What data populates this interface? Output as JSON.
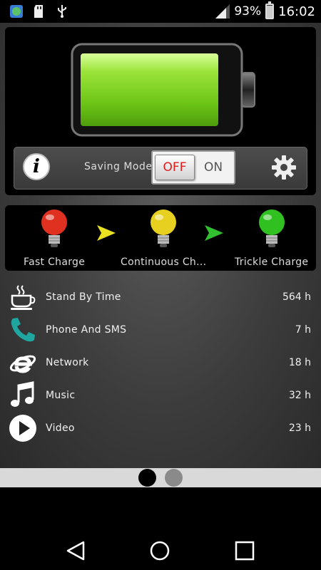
{
  "status_bar": {
    "battery_percent": "93%",
    "time": "16:02",
    "icons": [
      "app-icon",
      "sd-card-icon",
      "usb-icon",
      "signal-icon",
      "battery-charging-icon"
    ]
  },
  "battery": {
    "level": 0.93
  },
  "controls": {
    "info_icon_text": "i",
    "saving_mode_label": "Saving Mode",
    "toggle_off": "OFF",
    "toggle_on": "ON"
  },
  "stages": [
    {
      "label": "Fast Charge",
      "color": "#e03020"
    },
    {
      "label": "Continuous Ch...",
      "color": "#e8d020"
    },
    {
      "label": "Trickle Charge",
      "color": "#30c020"
    }
  ],
  "arrows": [
    {
      "color": "#e8e020"
    },
    {
      "color": "#30c030"
    }
  ],
  "usage": [
    {
      "icon": "coffee-cup-icon",
      "label": "Stand By Time",
      "value": "564 h"
    },
    {
      "icon": "phone-icon",
      "label": "Phone And SMS",
      "value": "7 h"
    },
    {
      "icon": "internet-explorer-icon",
      "label": "Network",
      "value": "18 h"
    },
    {
      "icon": "music-note-icon",
      "label": "Music",
      "value": "32 h"
    },
    {
      "icon": "play-icon",
      "label": "Video",
      "value": "23 h"
    }
  ],
  "pager": {
    "pages": 2,
    "current": 1
  },
  "nav": [
    "back-icon",
    "home-icon",
    "recents-icon"
  ]
}
